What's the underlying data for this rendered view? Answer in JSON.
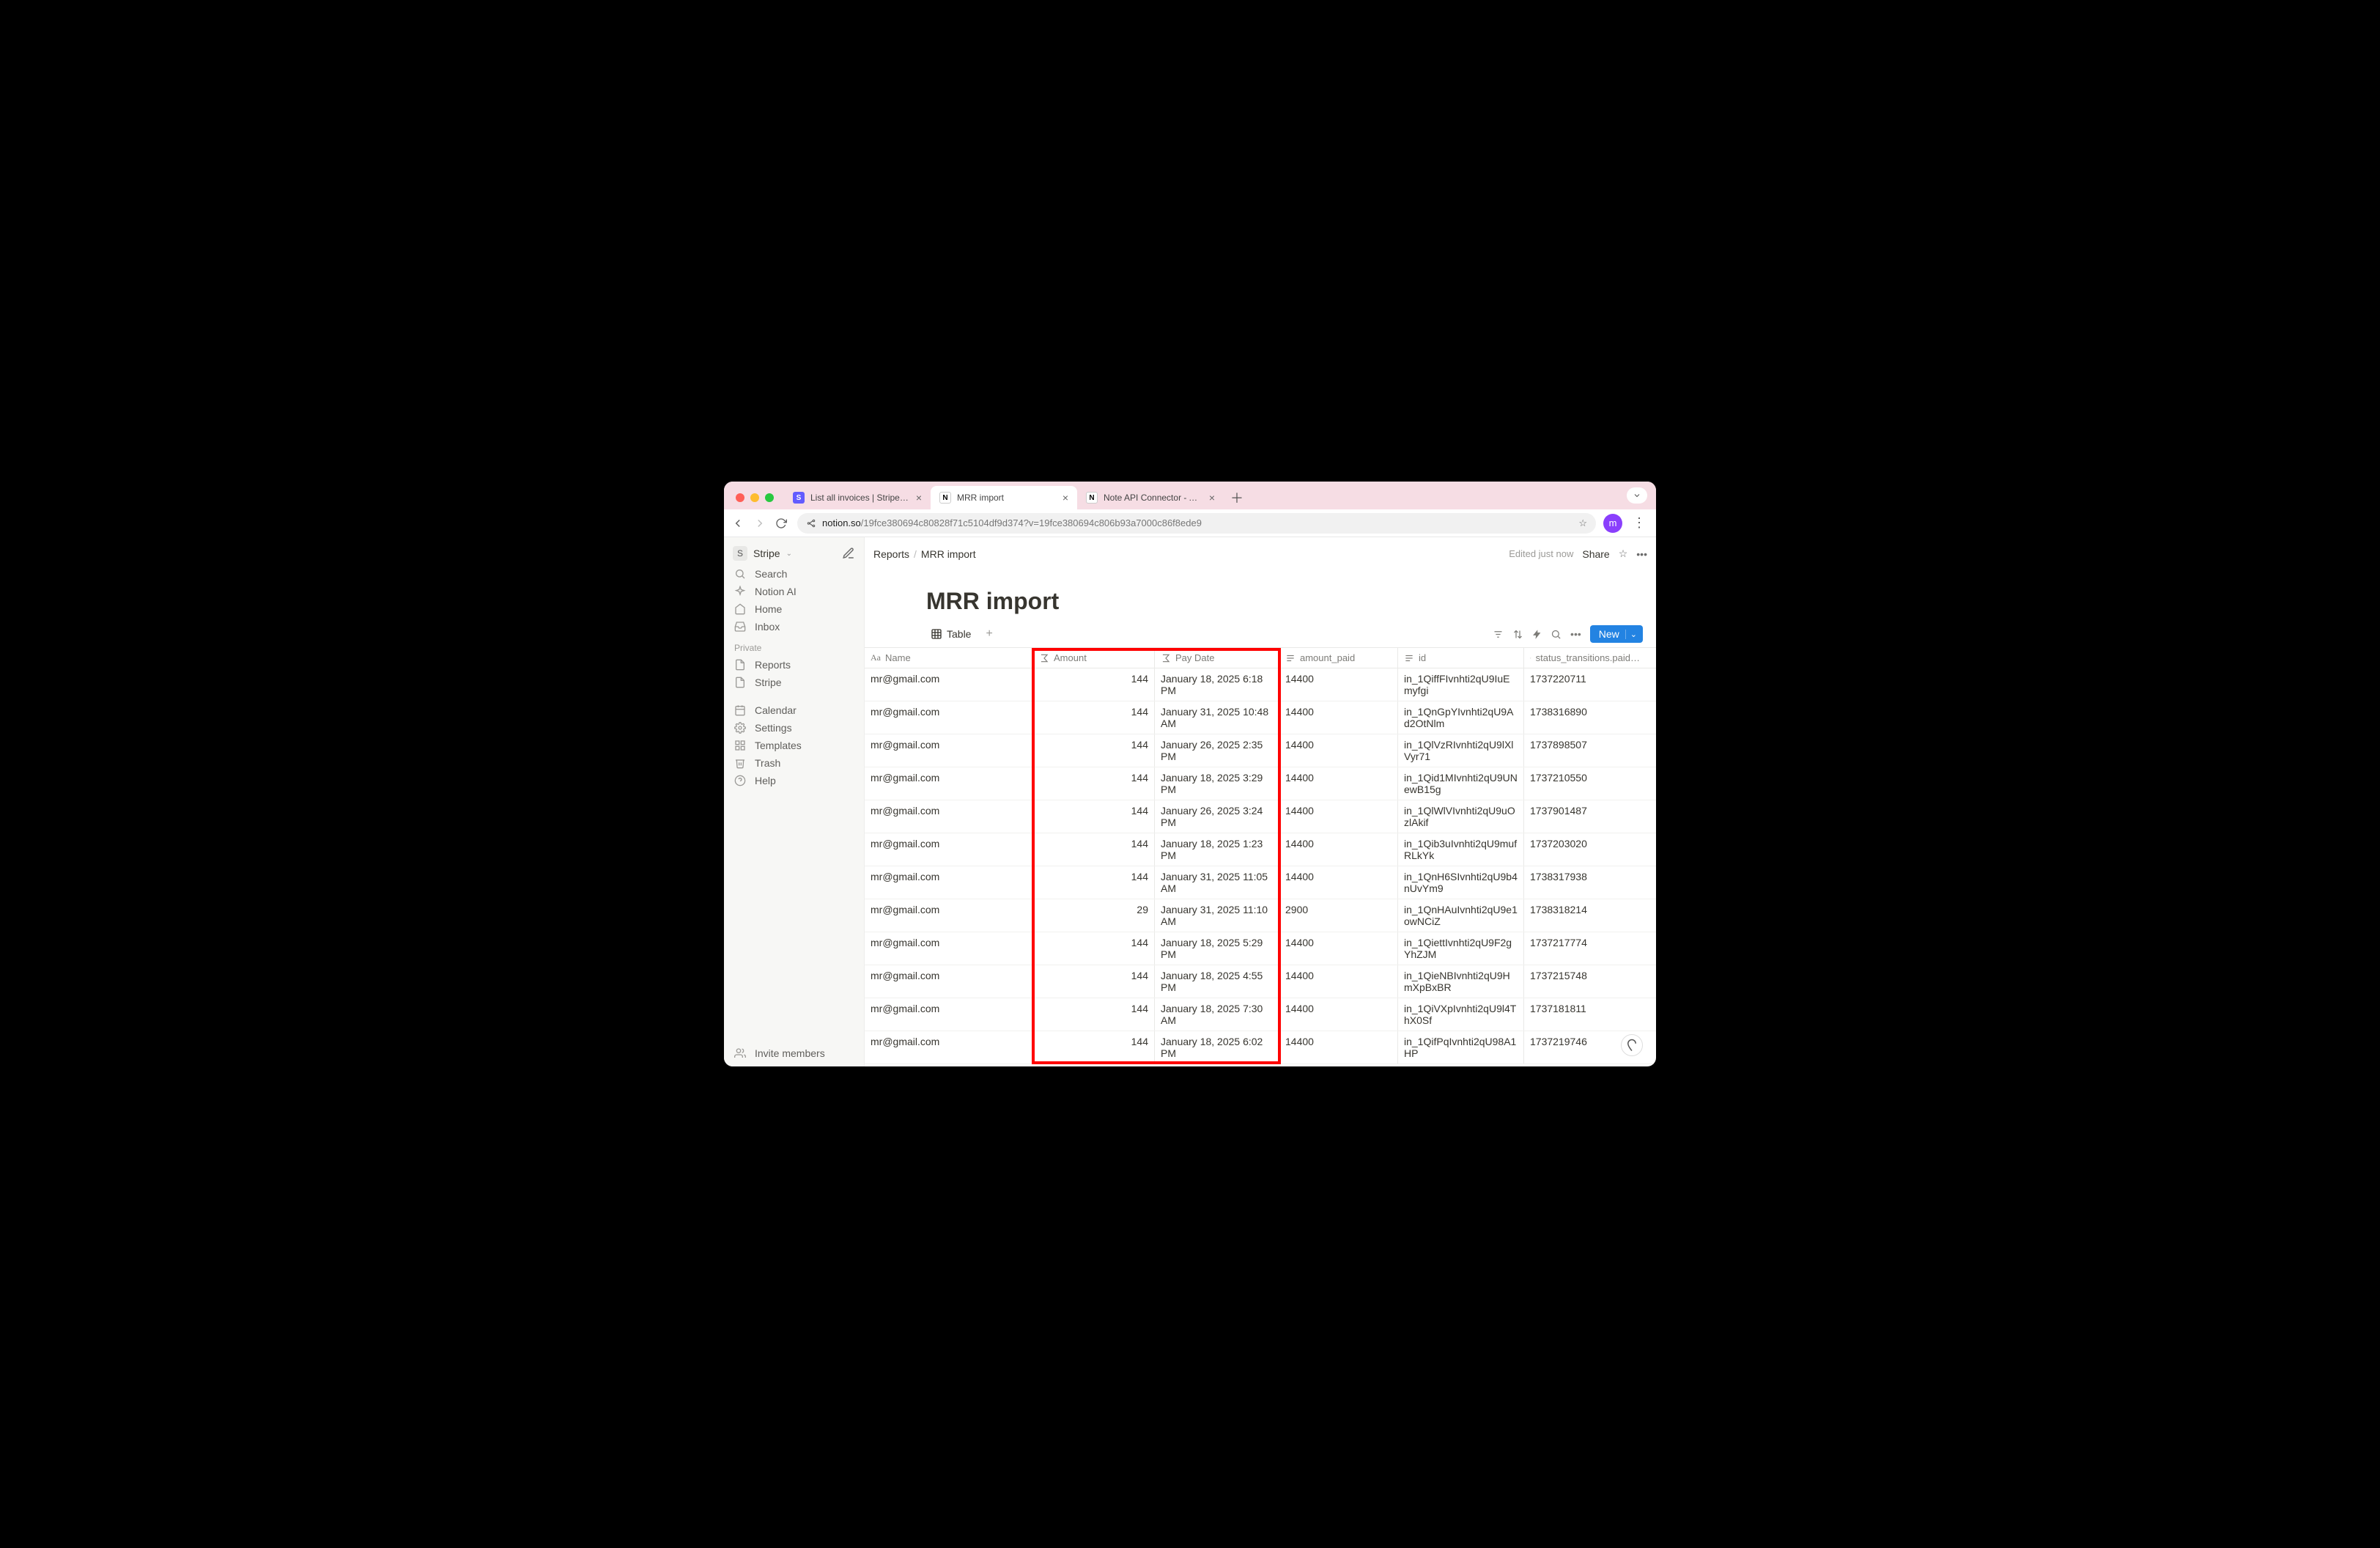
{
  "browser": {
    "tabs": [
      {
        "title": "List all invoices | Stripe API R",
        "favicon_bg": "#635bff",
        "favicon_letter": "S",
        "active": false
      },
      {
        "title": "MRR import",
        "favicon_bg": "#ffffff",
        "favicon_letter": "N",
        "favicon_color": "#000",
        "active": true
      },
      {
        "title": "Note API Connector - App",
        "favicon_bg": "#ffffff",
        "favicon_letter": "N",
        "favicon_color": "#000",
        "active": false
      }
    ],
    "url_domain": "notion.so",
    "url_path": "/19fce380694c80828f71c5104df9d374?v=19fce380694c806b93a7000c86f8ede9",
    "avatar_letter": "m"
  },
  "sidebar": {
    "workspace_badge": "S",
    "workspace_name": "Stripe",
    "top_items": [
      {
        "label": "Search"
      },
      {
        "label": "Notion AI"
      },
      {
        "label": "Home"
      },
      {
        "label": "Inbox"
      }
    ],
    "section_label": "Private",
    "private_items": [
      {
        "label": "Reports"
      },
      {
        "label": "Stripe"
      }
    ],
    "bottom_items": [
      {
        "label": "Calendar"
      },
      {
        "label": "Settings"
      },
      {
        "label": "Templates"
      },
      {
        "label": "Trash"
      },
      {
        "label": "Help"
      }
    ],
    "invite_label": "Invite members"
  },
  "topbar": {
    "crumb1": "Reports",
    "crumb2": "MRR import",
    "edited": "Edited just now",
    "share": "Share"
  },
  "page": {
    "title": "MRR import",
    "view_label": "Table",
    "new_button": "New"
  },
  "table": {
    "columns": [
      {
        "key": "name",
        "label": "Name",
        "type": "title"
      },
      {
        "key": "amount",
        "label": "Amount",
        "type": "formula"
      },
      {
        "key": "pay",
        "label": "Pay Date",
        "type": "formula"
      },
      {
        "key": "paid",
        "label": "amount_paid",
        "type": "text"
      },
      {
        "key": "id",
        "label": "id",
        "type": "text"
      },
      {
        "key": "status",
        "label": "status_transitions.paid…",
        "type": "text"
      }
    ],
    "rows": [
      {
        "name": "mr@gmail.com",
        "amount": "144",
        "pay": "January 18, 2025 6:18 PM",
        "paid": "14400",
        "id": "in_1QiffFIvnhti2qU9IuEmyfgi",
        "status": "1737220711"
      },
      {
        "name": "mr@gmail.com",
        "amount": "144",
        "pay": "January 31, 2025 10:48 AM",
        "paid": "14400",
        "id": "in_1QnGpYIvnhti2qU9Ad2OtNlm",
        "status": "1738316890"
      },
      {
        "name": "mr@gmail.com",
        "amount": "144",
        "pay": "January 26, 2025 2:35 PM",
        "paid": "14400",
        "id": "in_1QlVzRIvnhti2qU9lXlVyr71",
        "status": "1737898507"
      },
      {
        "name": "mr@gmail.com",
        "amount": "144",
        "pay": "January 18, 2025 3:29 PM",
        "paid": "14400",
        "id": "in_1Qid1MIvnhti2qU9UNewB15g",
        "status": "1737210550"
      },
      {
        "name": "mr@gmail.com",
        "amount": "144",
        "pay": "January 26, 2025 3:24 PM",
        "paid": "14400",
        "id": "in_1QlWlVIvnhti2qU9uOzlAkif",
        "status": "1737901487"
      },
      {
        "name": "mr@gmail.com",
        "amount": "144",
        "pay": "January 18, 2025 1:23 PM",
        "paid": "14400",
        "id": "in_1Qib3uIvnhti2qU9mufRLkYk",
        "status": "1737203020"
      },
      {
        "name": "mr@gmail.com",
        "amount": "144",
        "pay": "January 31, 2025 11:05 AM",
        "paid": "14400",
        "id": "in_1QnH6SIvnhti2qU9b4nUvYm9",
        "status": "1738317938"
      },
      {
        "name": "mr@gmail.com",
        "amount": "29",
        "pay": "January 31, 2025 11:10 AM",
        "paid": "2900",
        "id": "in_1QnHAuIvnhti2qU9e1owNCiZ",
        "status": "1738318214"
      },
      {
        "name": "mr@gmail.com",
        "amount": "144",
        "pay": "January 18, 2025 5:29 PM",
        "paid": "14400",
        "id": "in_1QiettIvnhti2qU9F2gYhZJM",
        "status": "1737217774"
      },
      {
        "name": "mr@gmail.com",
        "amount": "144",
        "pay": "January 18, 2025 4:55 PM",
        "paid": "14400",
        "id": "in_1QieNBIvnhti2qU9HmXpBxBR",
        "status": "1737215748"
      },
      {
        "name": "mr@gmail.com",
        "amount": "144",
        "pay": "January 18, 2025 7:30 AM",
        "paid": "14400",
        "id": "in_1QiVXpIvnhti2qU9l4ThX0Sf",
        "status": "1737181811"
      },
      {
        "name": "mr@gmail.com",
        "amount": "144",
        "pay": "January 18, 2025 6:02 PM",
        "paid": "14400",
        "id": "in_1QifPqIvnhti2qU98A1HP",
        "status": "1737219746"
      }
    ]
  }
}
